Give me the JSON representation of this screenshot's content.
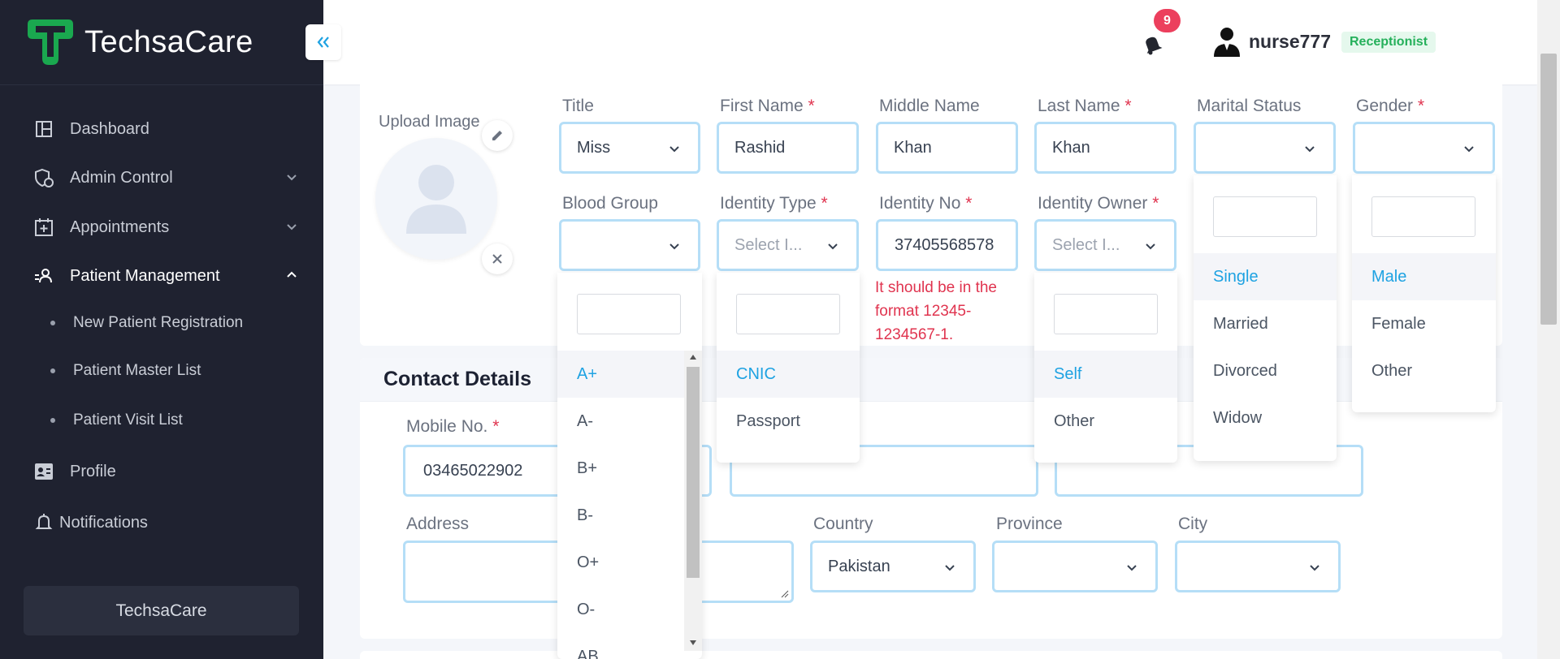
{
  "brand": {
    "name": "TechsaCare",
    "accent": "#1aa84f"
  },
  "sidebar": {
    "items": [
      {
        "label": "Dashboard",
        "icon": "dashboard-icon"
      },
      {
        "label": "Admin Control",
        "icon": "admin-shield-icon"
      },
      {
        "label": "Appointments",
        "icon": "calendar-plus-icon"
      },
      {
        "label": "Patient Management",
        "icon": "patient-icon"
      },
      {
        "label": "Profile",
        "icon": "profile-card-icon"
      },
      {
        "label": "Notifications",
        "icon": "bell-icon"
      }
    ],
    "sub_items": [
      {
        "label": "New Patient Registration"
      },
      {
        "label": "Patient Master List"
      },
      {
        "label": "Patient Visit List"
      }
    ],
    "footer": "TechsaCare"
  },
  "header": {
    "notification_count": "9",
    "username": "nurse777",
    "role": "Receptionist"
  },
  "form": {
    "upload_label": "Upload Image",
    "title": {
      "label": "Title",
      "value": "Miss"
    },
    "first_name": {
      "label": "First Name",
      "value": "Rashid"
    },
    "middle_name": {
      "label": "Middle Name",
      "value": "Khan"
    },
    "last_name": {
      "label": "Last Name",
      "value": "Khan"
    },
    "marital_status": {
      "label": "Marital Status",
      "value": ""
    },
    "gender": {
      "label": "Gender",
      "value": ""
    },
    "blood_group": {
      "label": "Blood Group",
      "value": ""
    },
    "identity_type": {
      "label": "Identity Type",
      "placeholder": "Select I..."
    },
    "identity_no": {
      "label": "Identity No",
      "value": "37405568578",
      "error": "It should be in the format 12345-1234567-1."
    },
    "identity_owner": {
      "label": "Identity Owner",
      "placeholder": "Select I..."
    },
    "required_mark": "*"
  },
  "contact": {
    "title": "Contact Details",
    "mobile": {
      "label": "Mobile No.",
      "value": "03465022902"
    },
    "address": {
      "label": "Address",
      "value": ""
    },
    "country": {
      "label": "Country",
      "value": "Pakistan"
    },
    "province": {
      "label": "Province",
      "value": ""
    },
    "city": {
      "label": "City",
      "value": ""
    }
  },
  "dropdowns": {
    "blood_group": [
      "A+",
      "A-",
      "B+",
      "B-",
      "O+",
      "O-",
      "AB"
    ],
    "identity_type": [
      "CNIC",
      "Passport"
    ],
    "identity_owner": [
      "Self",
      "Other"
    ],
    "marital_status": [
      "Single",
      "Married",
      "Divorced",
      "Widow"
    ],
    "gender": [
      "Male",
      "Female",
      "Other"
    ]
  },
  "colors": {
    "selected_option": "#1ea2e2",
    "error": "#e0344f",
    "input_border": "#b5def7",
    "sidebar_bg": "#1f2230"
  }
}
